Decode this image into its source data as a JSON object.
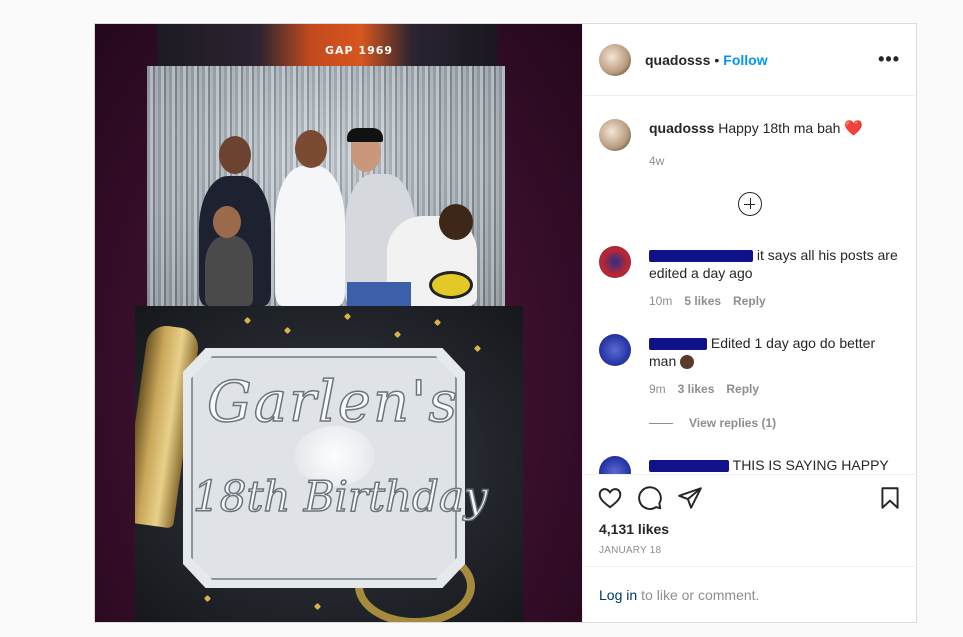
{
  "post": {
    "username": "quadosss",
    "separator": "•",
    "follow_label": "Follow",
    "more_icon": "more-horizontal-icon"
  },
  "photo": {
    "shirt_text": "GAP 1969",
    "card_line1": "Garlen's",
    "card_line2": "18th Birthday"
  },
  "caption": {
    "username": "quadosss",
    "text": "Happy 18th ma bah",
    "emoji": "❤️",
    "time": "4w"
  },
  "load_more_icon": "plus-circle-icon",
  "comments": [
    {
      "text": "it says all his posts are edited a day ago",
      "time": "10m",
      "likes": "5 likes",
      "reply": "Reply"
    },
    {
      "text": "Edited 1 day ago do better man",
      "time": "9m",
      "likes": "3 likes",
      "reply": "Reply"
    },
    {
      "text": "THIS IS SAYING HAPPY"
    }
  ],
  "view_replies": "View replies (1)",
  "actions": {
    "like_icon": "heart-icon",
    "comment_icon": "comment-icon",
    "share_icon": "share-icon",
    "save_icon": "bookmark-icon",
    "likes_count": "4,131 likes",
    "date": "JANUARY 18"
  },
  "login": {
    "link": "Log in",
    "text": "to like or comment."
  },
  "colors": {
    "follow": "#0095f6",
    "muted": "#8e8e8e",
    "text": "#262626",
    "heart": "#ed4956",
    "redaction": "#10128a"
  }
}
